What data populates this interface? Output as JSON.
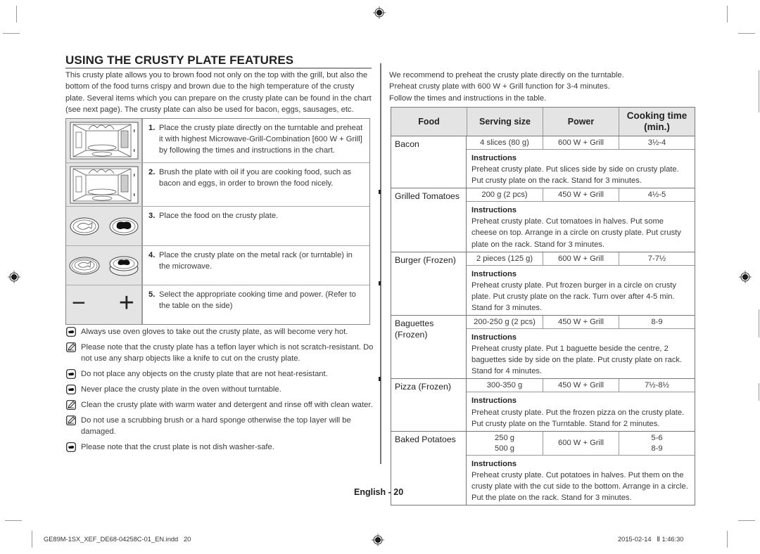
{
  "section": {
    "title": "USING THE CRUSTY PLATE FEATURES",
    "intro": "This crusty plate allows you to brown food not only on the top with the grill, but also the bottom of the food turns crispy and brown due to the high temperature of the crusty plate. Several items which you can prepare on the crusty plate can be found in the chart (see next page). The crusty plate can also be used for bacon, eggs, sausages, etc."
  },
  "steps": [
    {
      "num": "1.",
      "text": "Place the crusty plate directly on the turntable and preheat it with highest Microwave-Grill-Combination [600 W + Grill] by following the times and instructions in the chart.",
      "image": "microwave-interior"
    },
    {
      "num": "2.",
      "text": "Brush the plate with oil if you are cooking food, such as bacon and eggs, in order to brown the food nicely.",
      "image": "microwave-interior"
    },
    {
      "num": "3.",
      "text": "Place the food on the crusty plate.",
      "image": "plates-with-food"
    },
    {
      "num": "4.",
      "text": "Place the crusty plate on the metal rack (or turntable) in the microwave.",
      "image": "plates-on-rack"
    },
    {
      "num": "5.",
      "text": "Select the appropriate cooking time and power. (Refer to the table on the side)",
      "image": "minus-plus-controls",
      "minus": "−",
      "plus": "+"
    }
  ],
  "notes": [
    {
      "icon": "hand-pointer-icon",
      "text": "Always use oven gloves to take out the crusty plate, as will become very hot."
    },
    {
      "icon": "note-pencil-icon",
      "text": "Please note that the crusty plate has a teflon layer which is not scratch-resistant. Do not use any sharp objects like a knife to cut on the crusty plate."
    },
    {
      "icon": "hand-pointer-icon",
      "text": "Do not place any objects on the crusty plate that are not heat-resistant."
    },
    {
      "icon": "hand-pointer-icon",
      "text": "Never place the crusty plate in the oven without turntable."
    },
    {
      "icon": "note-pencil-icon",
      "text": "Clean the crusty plate with warm water and detergent and rinse off with clean water."
    },
    {
      "icon": "note-pencil-icon",
      "text": "Do not use a scrubbing brush or a hard sponge otherwise the top layer will be damaged."
    },
    {
      "icon": "hand-pointer-icon",
      "text": "Please note that the crust plate is not dish washer-safe."
    }
  ],
  "right_intro": [
    "We recommend to preheat the crusty plate directly on the turntable.",
    "Preheat crusty plate with 600 W + Grill function for 3-4 minutes.",
    "Follow the times and instructions in the table."
  ],
  "cooking_table": {
    "headers": {
      "food": "Food",
      "serving": "Serving size",
      "power": "Power",
      "time": "Cooking time (min.)"
    },
    "instructions_label": "Instructions",
    "rows": [
      {
        "food": "Bacon",
        "serving": "4 slices (80 g)",
        "power": "600 W + Grill",
        "time": "3½-4",
        "instructions": "Preheat crusty plate. Put slices side by side on crusty plate. Put crusty plate on the rack. Stand for 3 minutes."
      },
      {
        "food": "Grilled Tomatoes",
        "serving": "200 g (2 pcs)",
        "power": "450 W + Grill",
        "time": "4½-5",
        "instructions": "Preheat crusty plate. Cut tomatoes in halves. Put some cheese on top. Arrange in a circle on crusty plate. Put crusty plate on the rack. Stand for 3 minutes."
      },
      {
        "food": "Burger (Frozen)",
        "serving": "2 pieces (125 g)",
        "power": "600 W + Grill",
        "time": "7-7½",
        "instructions": "Preheat crusty plate. Put frozen burger in a circle on crusty plate. Put crusty plate on the rack. Turn over after 4-5 min. Stand for 3 minutes."
      },
      {
        "food": "Baguettes (Frozen)",
        "serving": "200-250 g (2 pcs)",
        "power": "450 W + Grill",
        "time": "8-9",
        "instructions": "Preheat crusty plate. Put 1 baguette beside the centre, 2 baguettes side by side on the plate. Put crusty plate on rack. Stand for 4 minutes."
      },
      {
        "food": "Pizza (Frozen)",
        "serving": "300-350 g",
        "power": "450 W + Grill",
        "time": "7½-8½",
        "instructions": "Preheat crusty plate. Put the frozen pizza on the crusty plate. Put crusty plate on the Turntable. Stand for 2 minutes."
      },
      {
        "food": "Baked Potatoes",
        "serving": "250 g\n500 g",
        "power": "600 W + Grill",
        "time": "5-6\n8-9",
        "instructions": "Preheat crusty plate. Cut potatoes in halves. Put them on the crusty plate with the cut side to the bottom. Arrange in a circle. Put the plate on the rack. Stand for 3 minutes."
      }
    ]
  },
  "page_label": "English - 20",
  "footer": {
    "file": "GE89M-1SX_XEF_DE68-04258C-01_EN.indd   20",
    "date": "2015-02-14   Ⅱ 1:46:30"
  }
}
